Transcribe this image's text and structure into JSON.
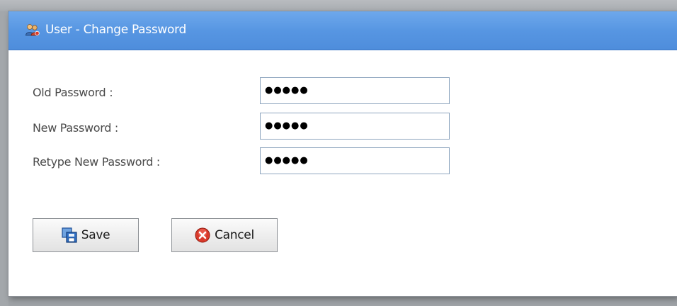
{
  "dialog": {
    "title": "User - Change Password",
    "title_icon": "users-icon"
  },
  "form": {
    "fields": [
      {
        "label": "Old Password :",
        "value": "●●●●●"
      },
      {
        "label": "New Password :",
        "value": "●●●●●"
      },
      {
        "label": "Retype New Password :",
        "value": "●●●●●"
      }
    ]
  },
  "buttons": {
    "save_label": "Save",
    "save_icon": "save-icon",
    "cancel_label": "Cancel",
    "cancel_icon": "cancel-icon"
  },
  "colors": {
    "titlebar": "#5796e2",
    "input_border": "#8fa6bf",
    "cancel_red": "#d93a2b"
  }
}
